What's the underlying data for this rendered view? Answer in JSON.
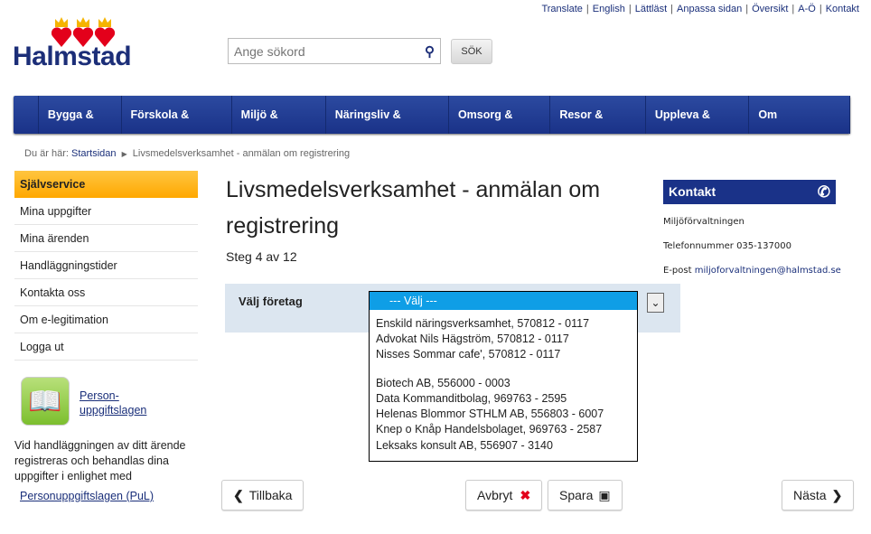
{
  "toplinks": [
    "Translate",
    "English",
    "Lättläst",
    "Anpassa sidan",
    "Översikt",
    "A-Ö",
    "Kontakt"
  ],
  "logo": {
    "text": "Halmstad"
  },
  "search": {
    "placeholder": "Ange sökord",
    "button": "SÖK"
  },
  "nav": [
    "Bygga & Bo",
    "Förskola & Skola",
    "Miljö & Energi",
    "Näringsliv & Arbete",
    "Omsorg & Stöd",
    "Resor & Trafik",
    "Uppleva & Göra",
    "Om kommunen"
  ],
  "breadcrumb": {
    "prefix": "Du är här:",
    "home": "Startsidan",
    "current": "Livsmedelsverksamhet - anmälan om registrering"
  },
  "sidebar": {
    "heading": "Självservice",
    "items": [
      "Mina uppgifter",
      "Mina ärenden",
      "Handläggningstider",
      "Kontakta oss",
      "Om e-legitimation",
      "Logga ut"
    ],
    "pul_link_1": "Person-",
    "pul_link_2": "uppgiftslagen",
    "text": "Vid handläggningen av ditt ärende registreras och behandlas dina uppgifter i enlighet med",
    "pul_link": "Personuppgiftslagen (PuL)"
  },
  "main": {
    "title": "Livsmedelsverksamhet - anmälan om registrering",
    "step": "Steg 4 av 12",
    "field_label": "Välj företag",
    "select": {
      "selected": "--- Välj ---",
      "options": [
        "Enskild näringsverksamhet,  570812 - 0117",
        "Advokat Nils Hägström,  570812 - 0117",
        "Nisses Sommar cafe', 570812 - 0117",
        "",
        "Biotech AB,  556000 - 0003",
        "Data Kommanditbolag,  969763 - 2595",
        "Helenas Blommor STHLM  AB, 556803 - 6007",
        "Knep o Knåp Handelsbolaget, 969763 - 2587",
        "Leksaks konsult AB,  556907 - 3140"
      ]
    },
    "buttons": {
      "back": "Tillbaka",
      "cancel": "Avbryt",
      "save": "Spara",
      "next": "Nästa"
    }
  },
  "contact": {
    "heading": "Kontakt",
    "org": "Miljöförvaltningen",
    "phone": "Telefonnummer 035-137000",
    "email_label": "E-post",
    "email": "miljoforvaltningen@halmstad.se"
  },
  "colors": {
    "nav": "#1a3288",
    "accent": "#ffa800",
    "select_highlight": "#0f9ee6"
  }
}
